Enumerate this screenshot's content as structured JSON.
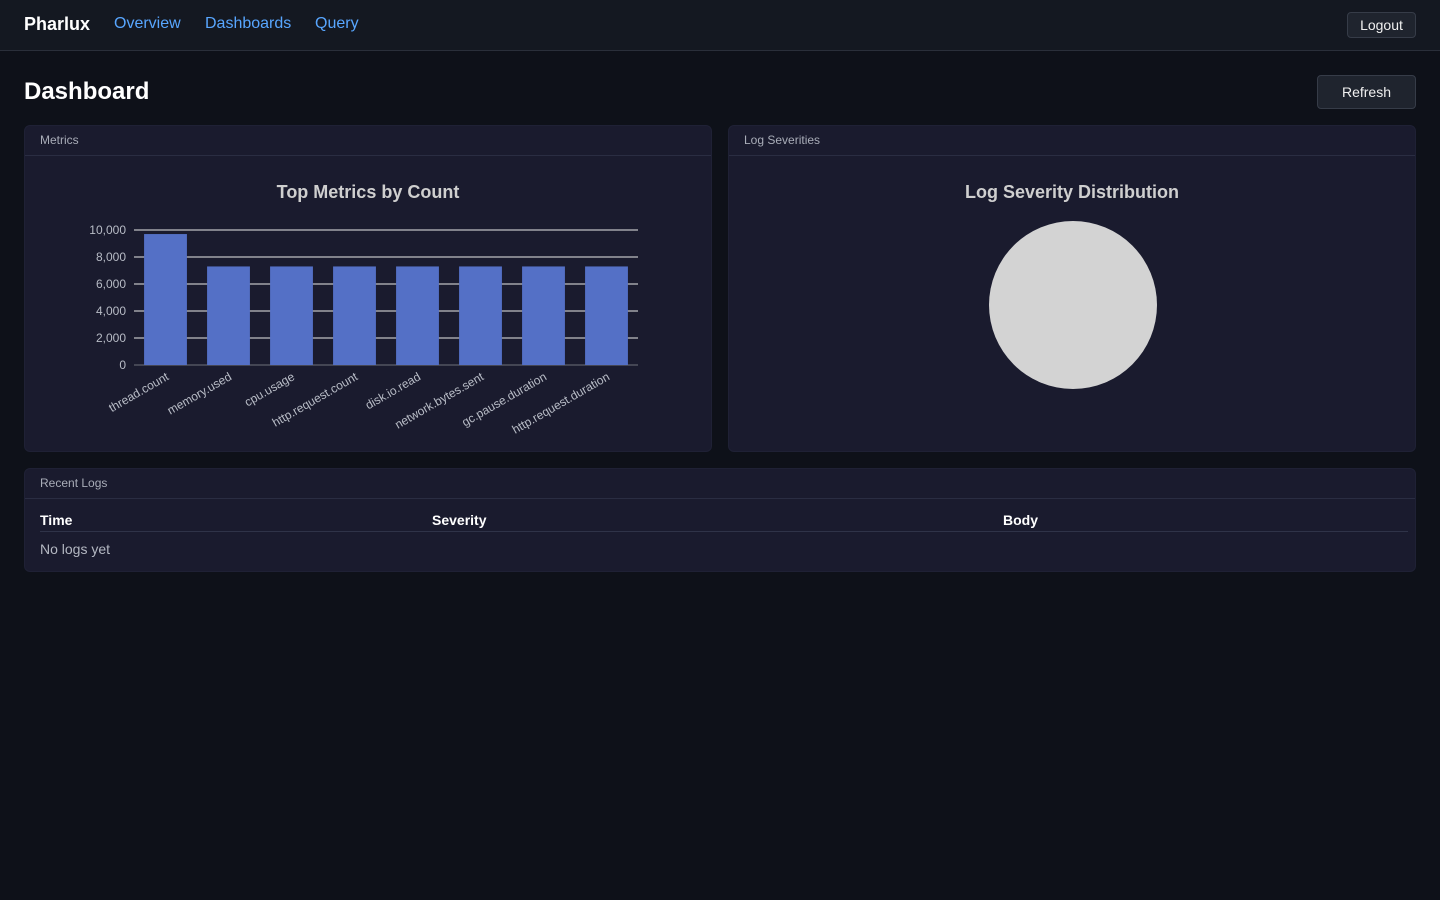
{
  "app": {
    "brand": "Pharlux",
    "nav": [
      {
        "label": "Overview"
      },
      {
        "label": "Dashboards"
      },
      {
        "label": "Query"
      }
    ],
    "logout_label": "Logout"
  },
  "page": {
    "title": "Dashboard",
    "refresh_label": "Refresh"
  },
  "metrics_panel": {
    "header": "Metrics"
  },
  "severity_panel": {
    "header": "Log Severities"
  },
  "logs_panel": {
    "header": "Recent Logs",
    "columns": [
      "Time",
      "Severity",
      "Body"
    ],
    "empty_text": "No logs yet"
  },
  "colors": {
    "accent_link": "#58a6ff",
    "bar": "#5470c6",
    "pie_empty": "#d3d3d3"
  },
  "chart_data": [
    {
      "type": "bar",
      "title": "Top Metrics by Count",
      "categories": [
        "thread.count",
        "memory.used",
        "cpu.usage",
        "http.request.count",
        "disk.io.read",
        "network.bytes.sent",
        "gc.pause.duration",
        "http.request.duration"
      ],
      "values": [
        9700,
        7300,
        7300,
        7300,
        7300,
        7300,
        7300,
        7300
      ],
      "ylim": [
        0,
        10000
      ],
      "yticks": [
        0,
        2000,
        4000,
        6000,
        8000,
        10000
      ],
      "ytick_labels": [
        "0",
        "2,000",
        "4,000",
        "6,000",
        "8,000",
        "10,000"
      ],
      "grid": true
    },
    {
      "type": "pie",
      "title": "Log Severity Distribution",
      "categories": [],
      "values": []
    }
  ]
}
